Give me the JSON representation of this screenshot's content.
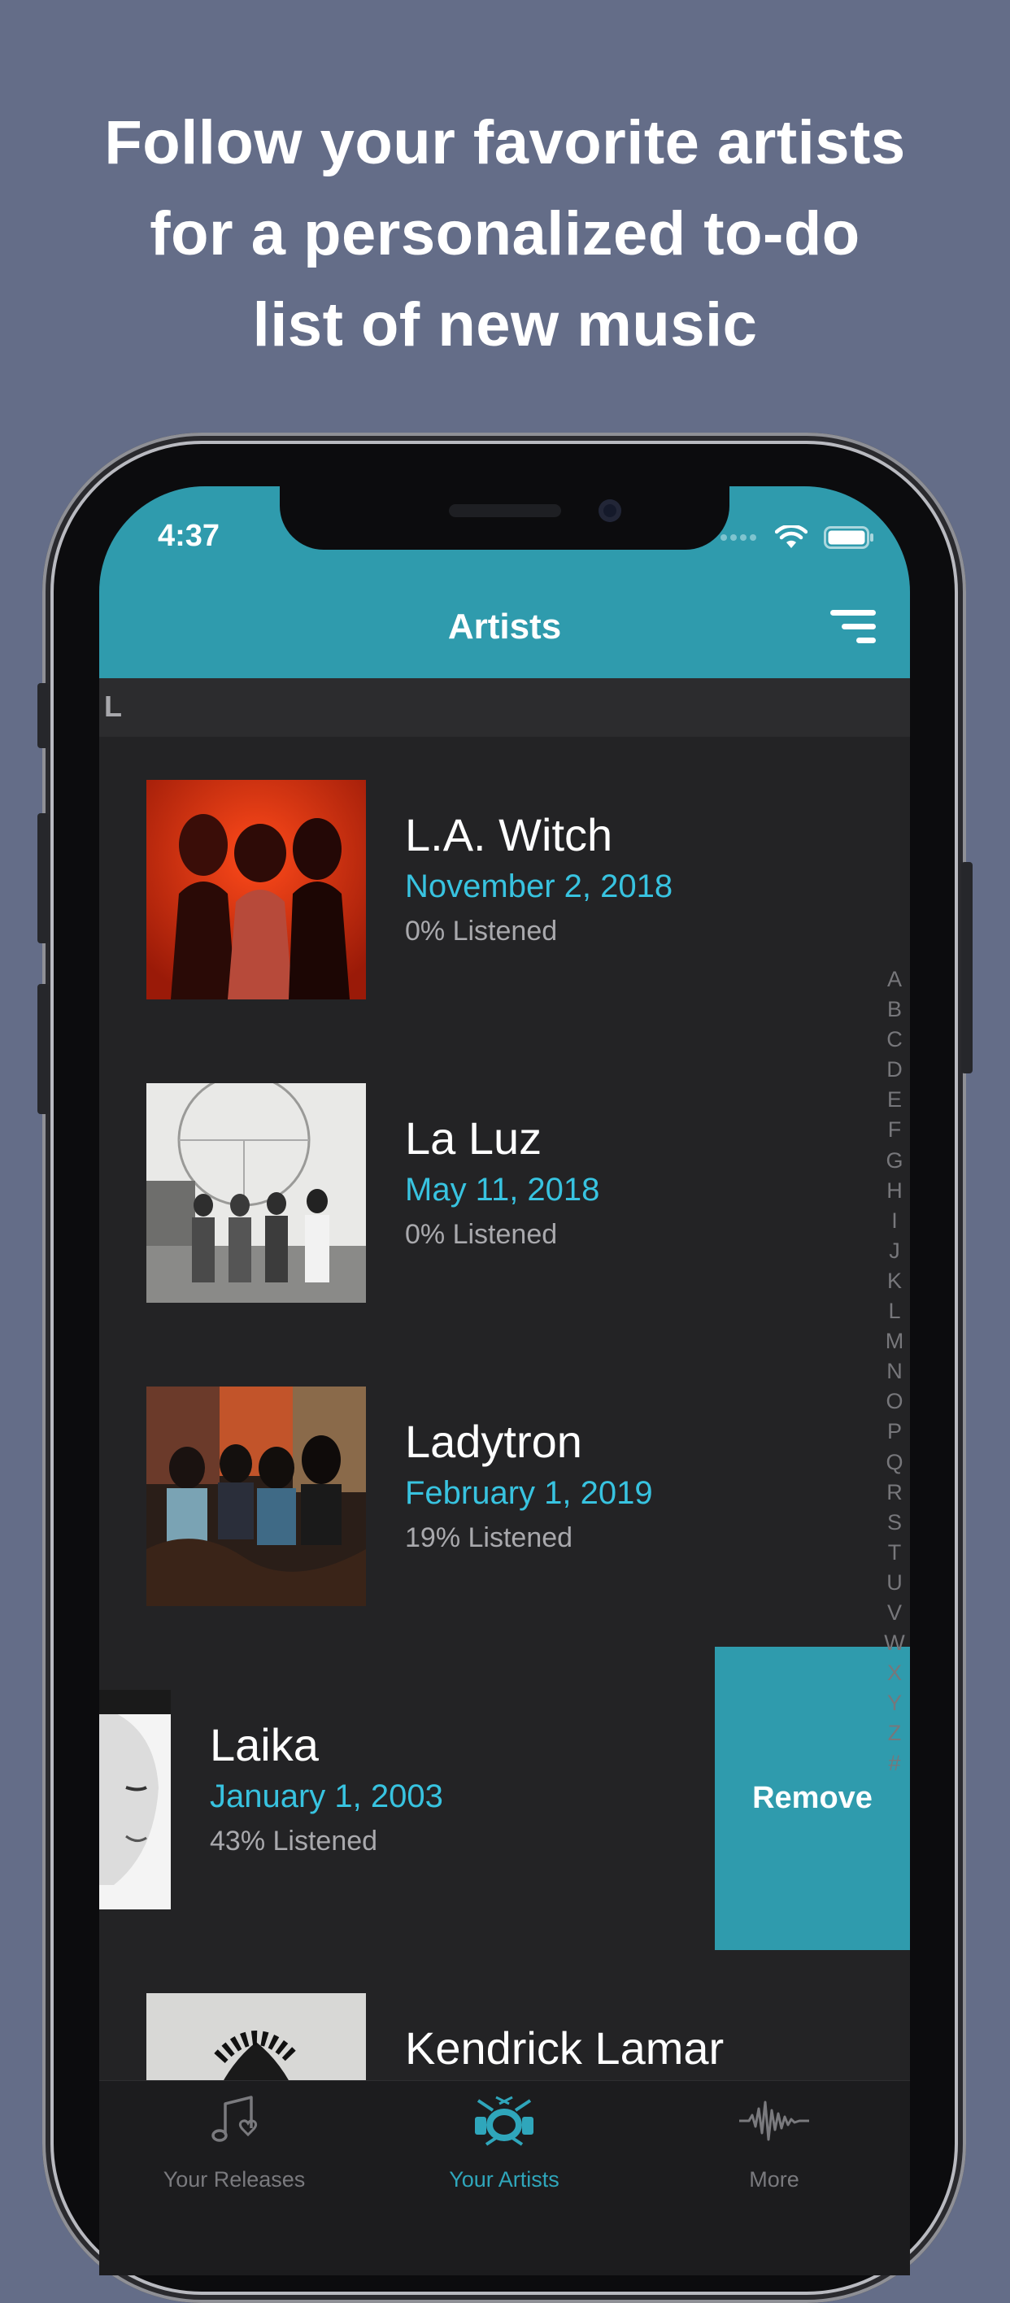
{
  "colors": {
    "background": "#646d88",
    "accent": "#2f9bad",
    "date": "#38c3e0"
  },
  "headline": {
    "line1": "Follow your favorite artists",
    "line2": "for a personalized to-do",
    "line3": "list of new music"
  },
  "status_bar": {
    "time": "4:37",
    "icons": [
      "signal-dots-icon",
      "wifi-icon",
      "battery-icon"
    ]
  },
  "nav": {
    "title": "Artists",
    "filter_icon": "filter-icon"
  },
  "section": {
    "letter": "L"
  },
  "artists": [
    {
      "name": "L.A. Witch",
      "date": "November 2, 2018",
      "listened": "0% Listened"
    },
    {
      "name": "La Luz",
      "date": "May 11, 2018",
      "listened": "0% Listened"
    },
    {
      "name": "Ladytron",
      "date": "February 1, 2019",
      "listened": "19% Listened"
    },
    {
      "name": "Laika",
      "date": "January 1, 2003",
      "listened": "43% Listened"
    },
    {
      "name": "Kendrick Lamar"
    }
  ],
  "swipe_action": {
    "label": "Remove"
  },
  "index_letters": [
    "A",
    "B",
    "C",
    "D",
    "E",
    "F",
    "G",
    "H",
    "I",
    "J",
    "K",
    "L",
    "M",
    "N",
    "O",
    "P",
    "Q",
    "R",
    "S",
    "T",
    "U",
    "V",
    "W",
    "X",
    "Y",
    "Z",
    "#"
  ],
  "tabs": [
    {
      "label": "Your Releases",
      "icon": "music-note-icon",
      "active": false
    },
    {
      "label": "Your Artists",
      "icon": "drum-kit-icon",
      "active": true
    },
    {
      "label": "More",
      "icon": "waveform-icon",
      "active": false
    }
  ]
}
